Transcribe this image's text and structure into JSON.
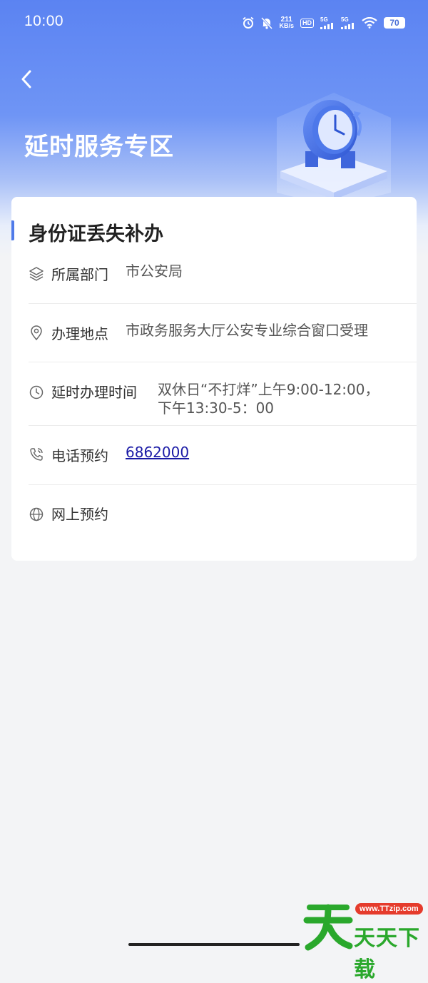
{
  "status_bar": {
    "time": "10:00",
    "network_speed_value": "211",
    "network_speed_unit": "KB/s",
    "hd_label": "HD",
    "signal1_label": "5G",
    "signal2_label": "5G",
    "battery": "70"
  },
  "header": {
    "title": "延时服务专区",
    "back_icon": "chevron-left-icon"
  },
  "card": {
    "title": "身份证丢失补办",
    "accent_color": "#4f7ae9",
    "rows": [
      {
        "icon": "layers-icon",
        "label": "所属部门",
        "value": "市公安局"
      },
      {
        "icon": "location-pin-icon",
        "label": "办理地点",
        "value": "市政务服务大厅公安专业综合窗口受理"
      },
      {
        "icon": "clock-icon",
        "label": "延时办理时间",
        "value_line1": "双休日“不打烊”上午9:00-12:00，",
        "value_line2": "下午13:30-5：00"
      },
      {
        "icon": "phone-icon",
        "label": "电话预约",
        "value": "6862000"
      },
      {
        "icon": "globe-icon",
        "label": "网上预约",
        "value": ""
      }
    ]
  },
  "watermark": {
    "url": "www.TTzip.com",
    "text": "天天下载"
  },
  "colors": {
    "header_start": "#5b83f2",
    "background": "#f3f4f6",
    "link": "#1a1aa6",
    "watermark_green": "#2aa82c",
    "watermark_red": "#e53b2c"
  }
}
